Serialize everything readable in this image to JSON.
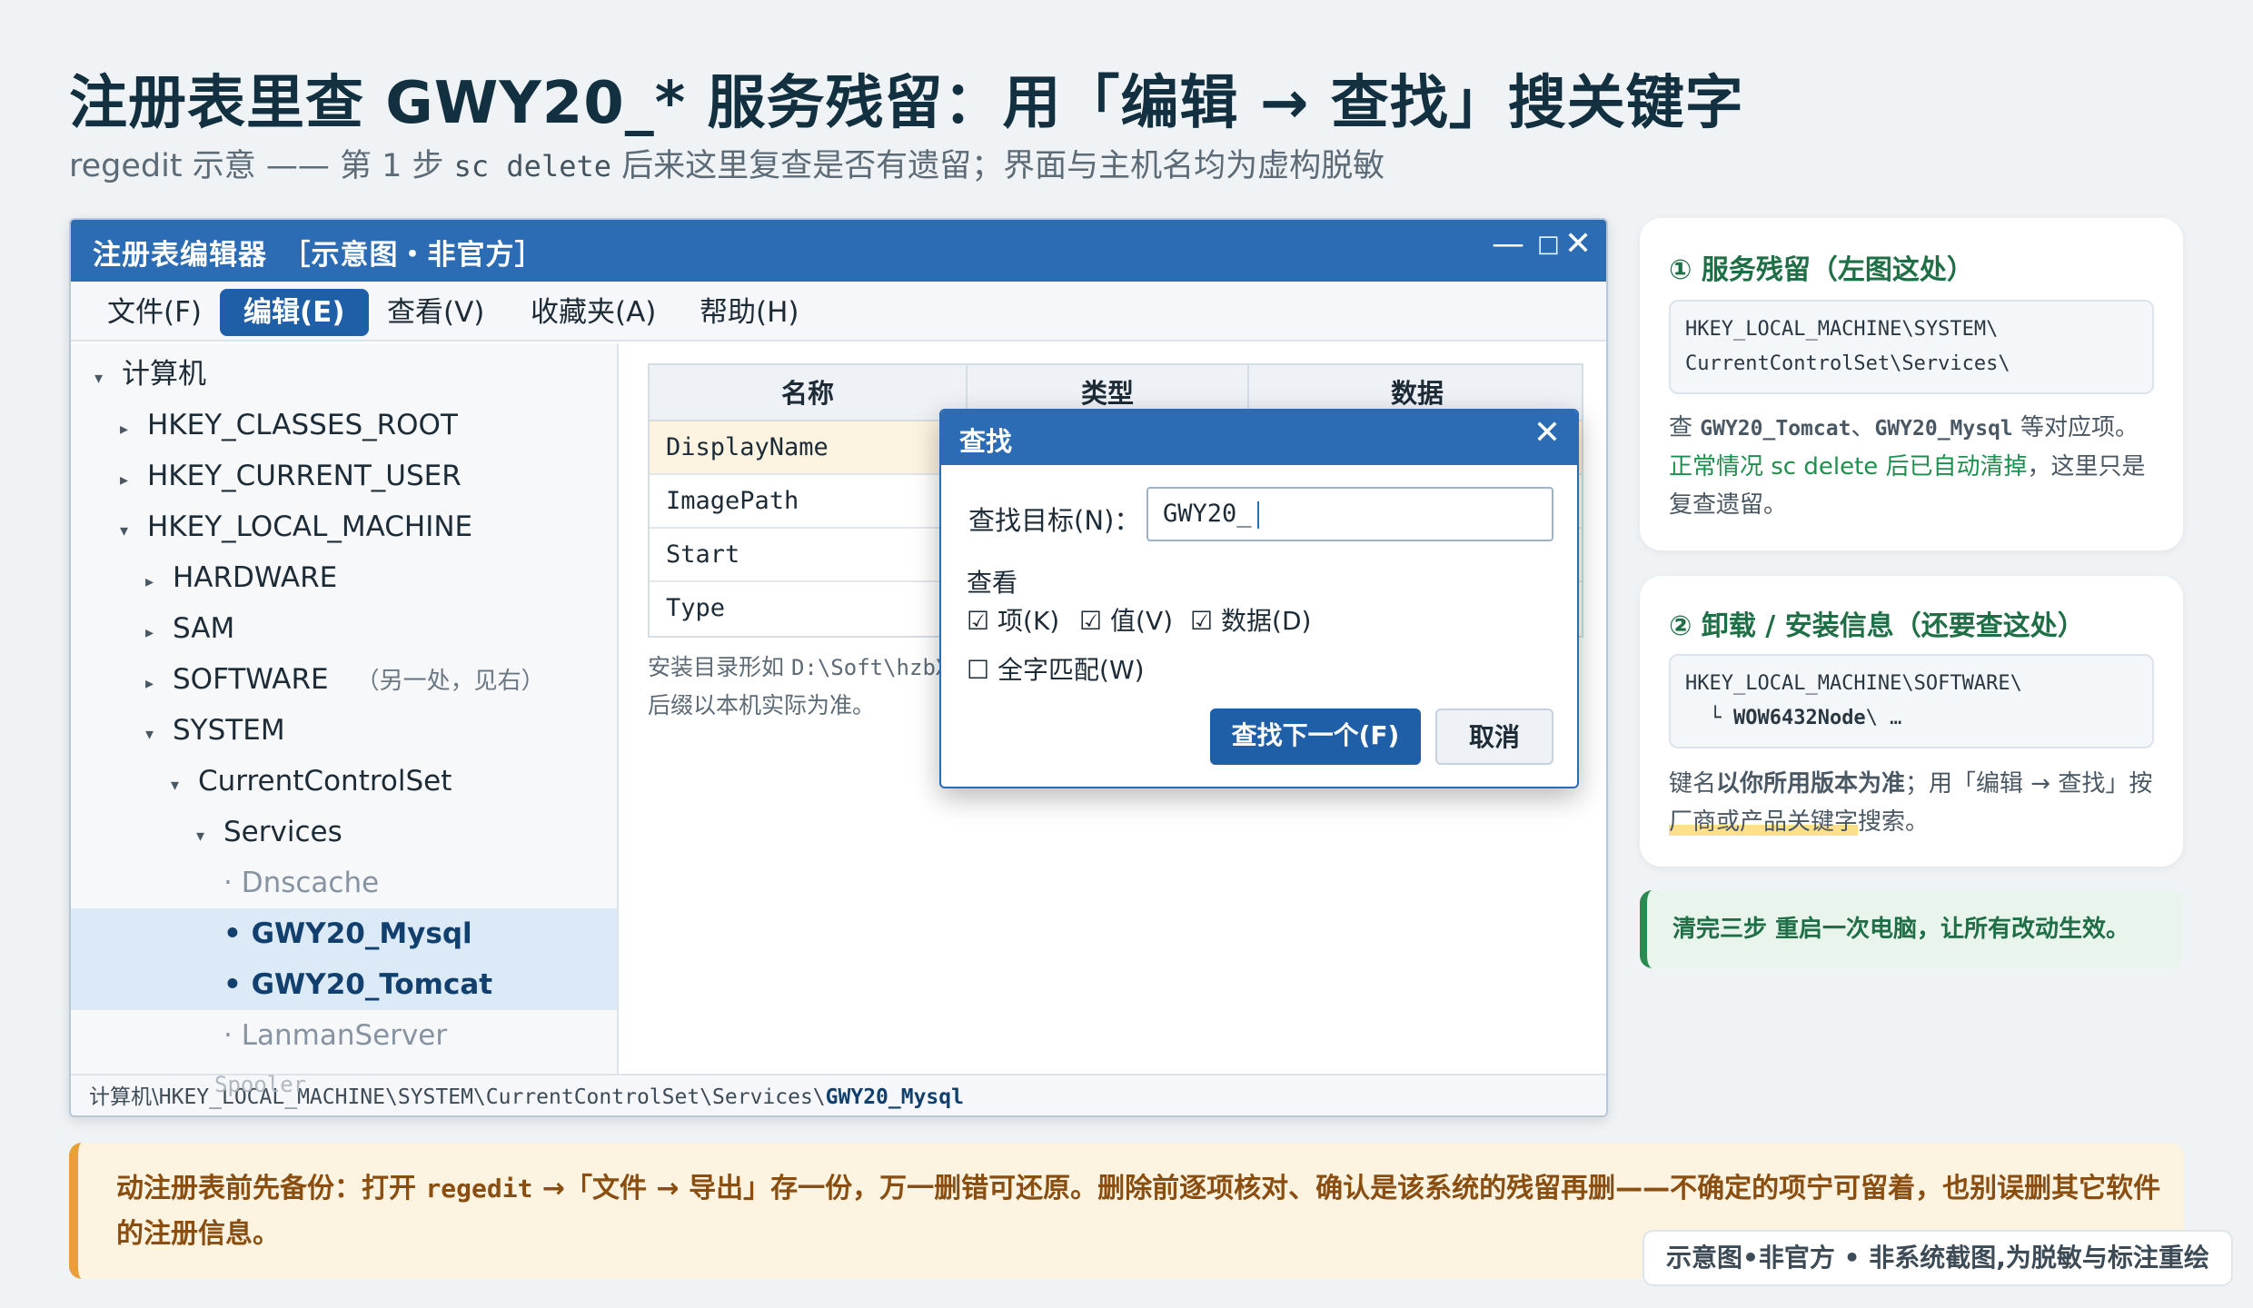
{
  "title": "注册表里查 GWY20_* 服务残留：用「编辑 → 查找」搜关键字",
  "subtitle": {
    "prefix": "regedit 示意 —— 第 1 步 ",
    "code": "sc delete",
    "suffix": " 后来这里复查是否有遗留；界面与主机名均为虚构脱敏"
  },
  "window": {
    "title": "注册表编辑器　［示意图・非官方］",
    "controls": {
      "minimize": "—",
      "maximize": "□",
      "close": "✕"
    },
    "menu": [
      "文件(F)",
      "编辑(E)",
      "查看(V)",
      "收藏夹(A)",
      "帮助(H)"
    ],
    "tree": [
      {
        "label": "计算机",
        "marker": "▾"
      },
      {
        "label": "HKEY_CLASSES_ROOT",
        "marker": "▸"
      },
      {
        "label": "HKEY_CURRENT_USER",
        "marker": "▸"
      },
      {
        "label": "HKEY_LOCAL_MACHINE",
        "marker": "▾"
      },
      {
        "label": "HARDWARE",
        "marker": "▸"
      },
      {
        "label": "SAM",
        "marker": "▸"
      },
      {
        "label": "SOFTWARE",
        "marker": "▸",
        "note": "（另一处，见右）"
      },
      {
        "label": "SYSTEM",
        "marker": "▾"
      },
      {
        "label": "CurrentControlSet",
        "marker": "▾"
      },
      {
        "label": "Services",
        "marker": "▾"
      },
      {
        "label": "· Dnscache"
      },
      {
        "label": "• GWY20_Mysql"
      },
      {
        "label": "• GWY20_Tomcat"
      },
      {
        "label": "· LanmanServer"
      }
    ],
    "columns": [
      "名称",
      "类型",
      "数据"
    ],
    "values": [
      "DisplayName",
      "ImagePath",
      "Start",
      "Type"
    ],
    "note": {
      "line1_prefix": "安装目录形如 ",
      "line1_code": "D:\\Soft\\hzbX",
      "line2": "后缀以本机实际为准。"
    },
    "status": {
      "prefix": "计算机\\",
      "path": "HKEY_LOCAL_MACHINE\\SYSTEM\\CurrentControlSet\\Services\\",
      "key": "GWY20_Mysql",
      "ghost": "Spooler"
    }
  },
  "find": {
    "title": "查找",
    "close": "✕",
    "target_label": "查找目标(N)：",
    "target_value": "GWY20_",
    "look_label": "查看",
    "options": [
      {
        "label": "项(K)",
        "checked": "☑"
      },
      {
        "label": "值(V)",
        "checked": "☑"
      },
      {
        "label": "数据(D)",
        "checked": "☑"
      }
    ],
    "whole": {
      "label": "全字匹配(W)",
      "checked": "☐"
    },
    "find_next": "查找下一个(F)",
    "cancel": "取消"
  },
  "card1": {
    "title": "① 服务残留（左图这处）",
    "code_line1": "HKEY_LOCAL_MACHINE\\SYSTEM\\",
    "code_line2": "CurrentControlSet\\Services\\",
    "t1": "查 ",
    "c1": "GWY20_Tomcat",
    "t2": "、",
    "c2": "GWY20_Mysql",
    "t3": " 等对应项。",
    "green": "正常情况 sc delete 后已自动清掉",
    "t4": "，这里只是复查遗留。"
  },
  "card2": {
    "title": "② 卸载 / 安装信息（还要查这处）",
    "code_line1": "HKEY_LOCAL_MACHINE\\SOFTWARE\\",
    "code_line2_prefix": "  └ ",
    "code_line2_bold": "WOW6432Node",
    "code_line2_suffix": "\\ …",
    "t1": "键名",
    "b1": "以你所用版本为准",
    "t2": "；用「编辑 → 查找」按",
    "hl": "厂商或产品关键字",
    "t3": "搜索。"
  },
  "tip": "清完三步 重启一次电脑，让所有改动生效。",
  "warning": {
    "t1": "动注册表前先备份：打开 ",
    "code": "regedit",
    "t2": " →「文件 → 导出」存一份，万一删错可还原。删除前逐项核对、确认是该系统的残留再删——不确定的项宁可留着，也别误删其它软件的注册信息。"
  },
  "footer": "示意图•非官方 • 非系统截图,为脱敏与标注重绘",
  "colors": {
    "titlebar": "#2b6cb5",
    "accent_green": "#1f8f4e",
    "warning": "#e8a13a"
  }
}
